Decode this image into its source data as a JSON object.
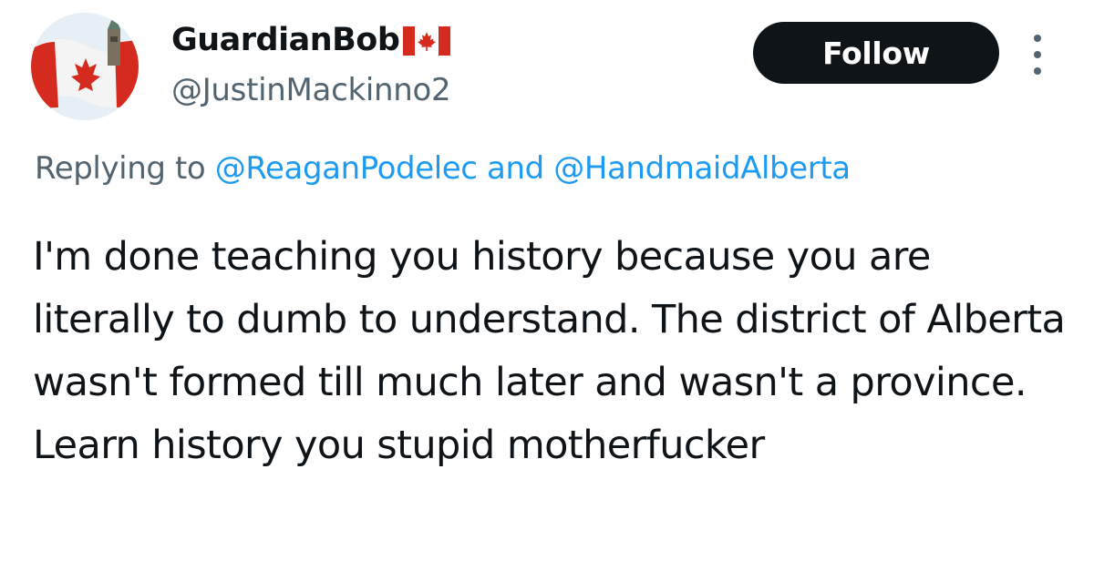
{
  "header": {
    "display_name": "GuardianBob",
    "handle": "@JustinMackinno2",
    "follow_label": "Follow"
  },
  "reply": {
    "prefix": "Replying to",
    "mention_1": "@ReaganPodelec",
    "joiner": "and",
    "mention_2": "@HandmaidAlberta"
  },
  "tweet": {
    "text": "I'm done teaching you history because you are literally to dumb to understand. The district of Alberta wasn't formed till much later and wasn't a province. Learn history you stupid motherfucker"
  },
  "icons": {
    "avatar": "canadian-flag-parliament-avatar",
    "flag": "canada-flag-icon",
    "more": "more-options-icon"
  },
  "colors": {
    "text": "#0f1419",
    "secondary": "#536471",
    "link": "#1d9bf0",
    "button_bg": "#0f1419",
    "button_text": "#ffffff",
    "flag_red": "#d52b1e"
  }
}
